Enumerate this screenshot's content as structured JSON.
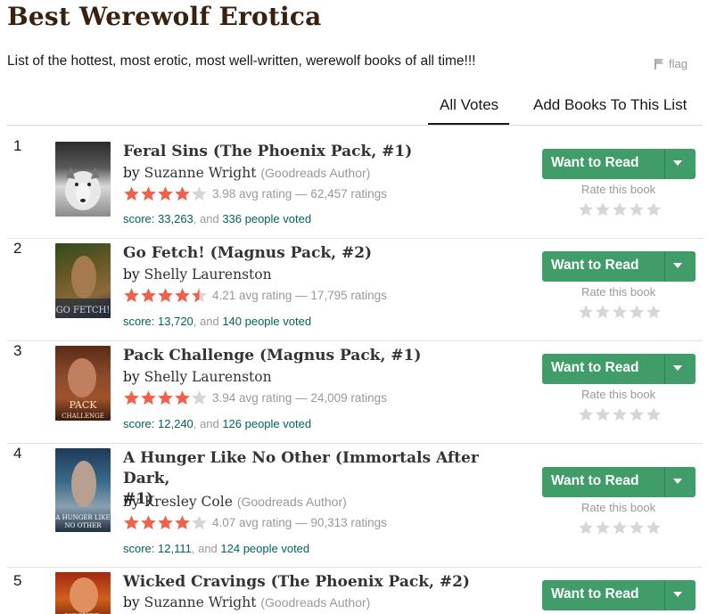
{
  "page": {
    "title": "Best Werewolf Erotica",
    "description": "List of the hottest, most erotic, most well-written, werewolf books of all time!!!",
    "flag_label": "flag"
  },
  "tabs": {
    "all_votes": "All Votes",
    "add_books": "Add Books To This List"
  },
  "colors": {
    "green_button": "#409d69",
    "star_orange": "#e87400",
    "link_teal": "#00635d"
  },
  "books": [
    {
      "rank": "1",
      "title_line1": "Feral Sins (The Phoenix Pack, #1)",
      "title_line2": "",
      "by": "by",
      "author": "Suzanne Wright",
      "author_tag": "(Goodreads Author)",
      "rating_text": "3.98 avg rating — 62,457 ratings",
      "rating_value": 3.98,
      "score_label": "score: 33,263",
      "score_mid": ", and ",
      "voters": "336 people voted",
      "button": "Want to Read",
      "rate_label": "Rate this book",
      "cover_text": ""
    },
    {
      "rank": "2",
      "title_line1": "Go Fetch! (Magnus Pack, #2)",
      "title_line2": "",
      "by": "by",
      "author": "Shelly Laurenston",
      "author_tag": "",
      "rating_text": "4.21 avg rating — 17,795 ratings",
      "rating_value": 4.21,
      "score_label": "score: 13,720",
      "score_mid": ", and ",
      "voters": "140 people voted",
      "button": "Want to Read",
      "rate_label": "Rate this book",
      "cover_text": ""
    },
    {
      "rank": "3",
      "title_line1": "Pack Challenge (Magnus Pack, #1)",
      "title_line2": "",
      "by": "by",
      "author": "Shelly Laurenston",
      "author_tag": "",
      "rating_text": "3.94 avg rating — 24,009 ratings",
      "rating_value": 3.94,
      "score_label": "score: 12,240",
      "score_mid": ", and ",
      "voters": "126 people voted",
      "button": "Want to Read",
      "rate_label": "Rate this book",
      "cover_text": ""
    },
    {
      "rank": "4",
      "title_line1": "A Hunger Like No Other (Immortals After Dark,",
      "title_line2": "#1)",
      "by": "by",
      "author": "Kresley Cole",
      "author_tag": "(Goodreads Author)",
      "rating_text": "4.07 avg rating — 90,313 ratings",
      "rating_value": 4.07,
      "score_label": "score: 12,111",
      "score_mid": ", and ",
      "voters": "124 people voted",
      "button": "Want to Read",
      "rate_label": "Rate this book",
      "cover_text": ""
    },
    {
      "rank": "5",
      "title_line1": "Wicked Cravings (The Phoenix Pack, #2)",
      "title_line2": "",
      "by": "by",
      "author": "Suzanne Wright",
      "author_tag": "(Goodreads Author)",
      "rating_text": "",
      "rating_value": null,
      "score_label": "",
      "score_mid": "",
      "voters": "",
      "button": "Want to Read",
      "rate_label": "",
      "cover_text": ""
    }
  ]
}
